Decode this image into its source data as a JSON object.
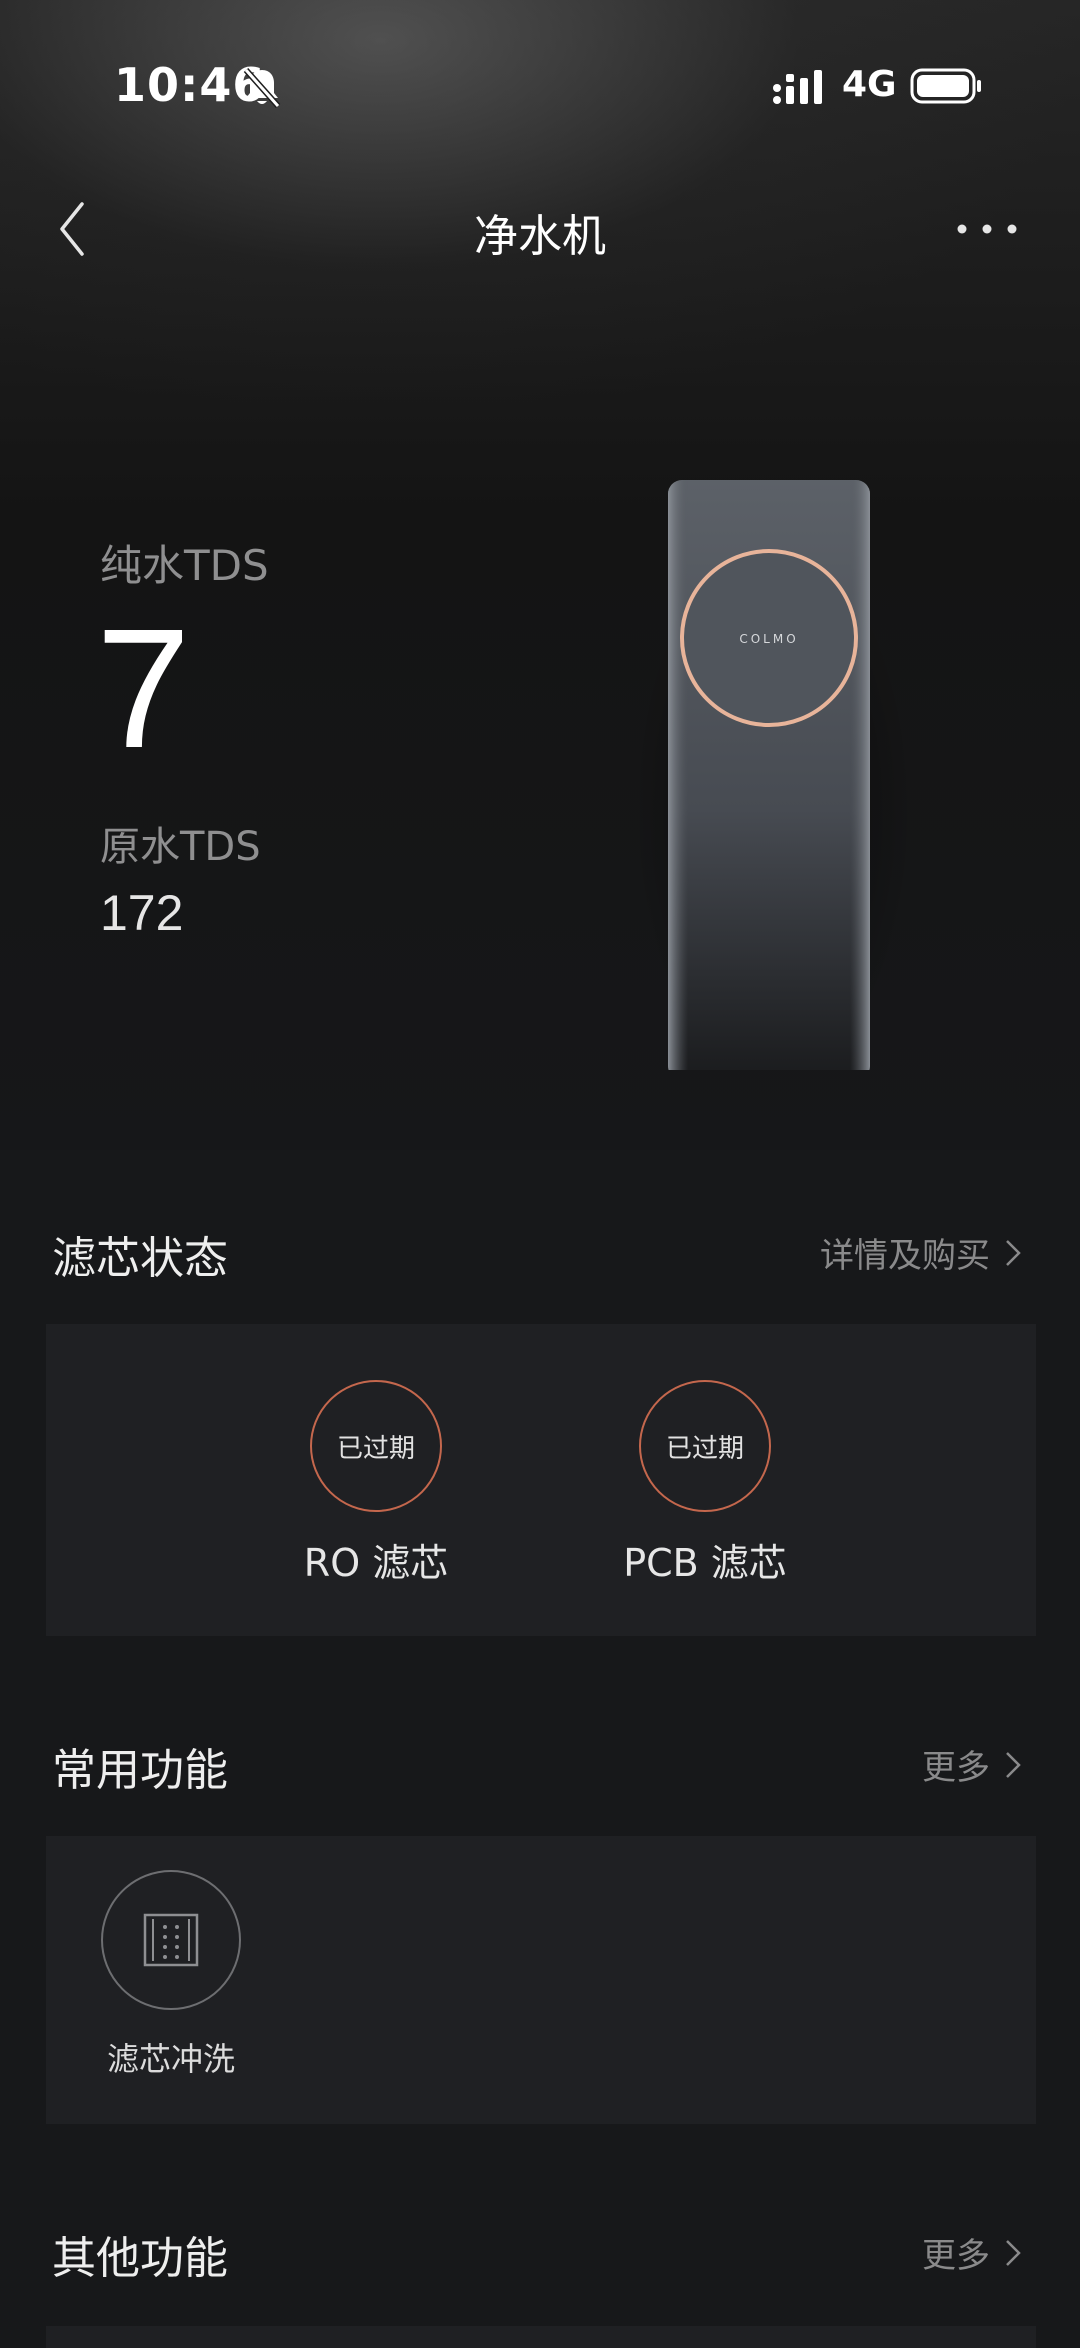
{
  "status_bar": {
    "time": "10:46",
    "network": "4G",
    "icons": [
      "bell-off-icon",
      "signal-icon",
      "battery-icon"
    ]
  },
  "nav": {
    "title": "净水机",
    "back_icon": "chevron-left-icon",
    "more_icon": "more-dots-icon"
  },
  "tds": {
    "pure_label": "纯水TDS",
    "pure_value": "7",
    "raw_label": "原水TDS",
    "raw_value": "172"
  },
  "device": {
    "brand": "COLMO"
  },
  "filter_section": {
    "title": "滤芯状态",
    "link": "详情及购买",
    "items": [
      {
        "status": "已过期",
        "name": "RO 滤芯"
      },
      {
        "status": "已过期",
        "name": "PCB 滤芯"
      }
    ]
  },
  "common_section": {
    "title": "常用功能",
    "link": "更多",
    "items": [
      {
        "label": "滤芯冲洗",
        "icon": "filter-flush-icon"
      }
    ]
  },
  "other_section": {
    "title": "其他功能",
    "link": "更多"
  },
  "colors": {
    "background": "#17181a",
    "panel": "#1f2023",
    "expired_ring": "#c4674d",
    "accent_ring": "#e8b49a"
  }
}
